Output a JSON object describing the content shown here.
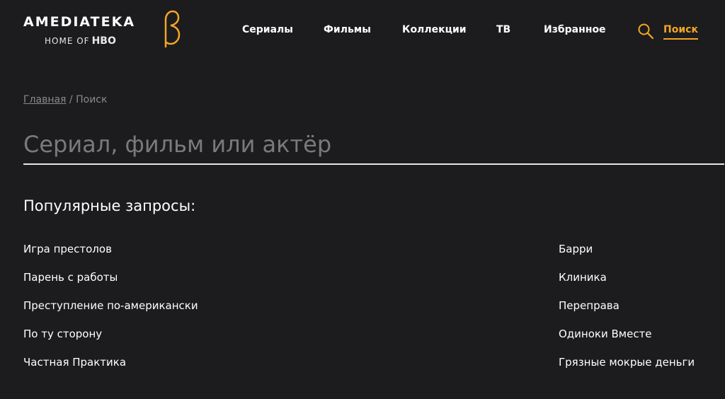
{
  "header": {
    "logo": {
      "main": "AMEDIATEKA",
      "sub_prefix": "HOME OF",
      "sub_brand": "HBO",
      "beta_symbol": "β"
    },
    "nav": [
      {
        "label": "Сериалы"
      },
      {
        "label": "Фильмы"
      },
      {
        "label": "Коллекции"
      },
      {
        "label": "ТВ"
      },
      {
        "label": "Избранное"
      }
    ],
    "search": {
      "label": "Поиск",
      "icon": "search-icon"
    }
  },
  "breadcrumb": {
    "home": "Главная",
    "separator": " / ",
    "current": "Поиск"
  },
  "search_field": {
    "placeholder": "Сериал, фильм или актёр",
    "value": ""
  },
  "popular": {
    "title": "Популярные запросы:",
    "left": [
      "Игра престолов",
      "Парень с работы",
      "Преступление по-американски",
      "По ту сторону",
      "Частная Практика"
    ],
    "right": [
      "Барри",
      "Клиника",
      "Переправа",
      "Одиноки Вместе",
      "Грязные мокрые деньги"
    ]
  },
  "colors": {
    "background": "#1c1c1e",
    "accent": "#f5a623",
    "text": "#ffffff",
    "muted": "#8a8a8c"
  }
}
